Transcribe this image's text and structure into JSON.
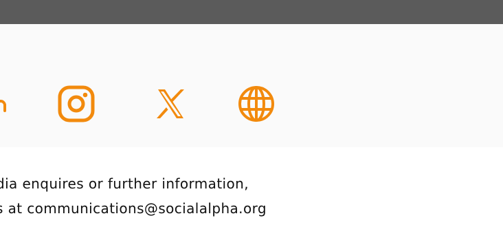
{
  "header": {
    "color": "#5b5b5b"
  },
  "social_links": [
    {
      "icon": "linkedin-icon"
    },
    {
      "icon": "instagram-icon"
    },
    {
      "icon": "x-icon"
    },
    {
      "icon": "globe-icon"
    }
  ],
  "contact": {
    "line_1": "dia enquires or further information,",
    "line_2": "s at communications@socialalpha.org"
  },
  "colors": {
    "accent": "#f28a0d",
    "band_background": "#fafafa",
    "text": "#111111"
  }
}
